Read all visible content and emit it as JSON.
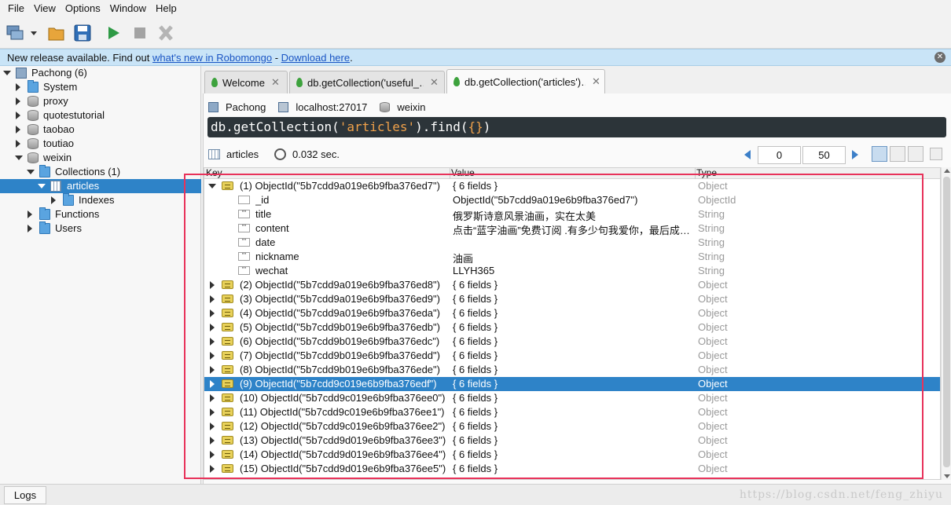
{
  "menu": [
    "File",
    "View",
    "Options",
    "Window",
    "Help"
  ],
  "banner": {
    "text_prefix": "New release available. Find out ",
    "link_whats_new": "what's new in Robomongo",
    "separator": " - ",
    "link_download": "Download here",
    "suffix": "."
  },
  "explorer": {
    "server": "Pachong (6)",
    "nodes": [
      "System",
      "proxy",
      "quotestutorial",
      "taobao",
      "toutiao",
      "weixin",
      "Collections (1)",
      "articles",
      "Indexes",
      "Functions",
      "Users"
    ]
  },
  "tabs": [
    {
      "label": "Welcome"
    },
    {
      "label": "db.getCollection('useful_…"
    },
    {
      "label": "db.getCollection('articles')…"
    }
  ],
  "connection": {
    "server": "Pachong",
    "host": "localhost:27017",
    "database": "weixin"
  },
  "query": {
    "prefix": "db.getCollection(",
    "collection": "'articles'",
    "middle": ").find(",
    "braces": "{}",
    "suffix": ")"
  },
  "result": {
    "collection": "articles",
    "time": "0.032 sec.",
    "skip": "0",
    "limit": "50"
  },
  "columns": {
    "key": "Key",
    "value": "Value",
    "type": "Type"
  },
  "rows": [
    {
      "key": "(1) ObjectId(\"5b7cdd9a019e6b9fba376ed7\")",
      "value": "{ 6 fields }",
      "type": "Object"
    },
    {
      "key": "_id",
      "value": "ObjectId(\"5b7cdd9a019e6b9fba376ed7\")",
      "type": "ObjectId"
    },
    {
      "key": "title",
      "value": "俄罗斯诗意风景油画，实在太美",
      "type": "String"
    },
    {
      "key": "content",
      "value": "点击“蓝字油画”免费订阅 .有多少句我爱你，最后成…",
      "type": "String"
    },
    {
      "key": "date",
      "value": "",
      "type": "String"
    },
    {
      "key": "nickname",
      "value": "油画",
      "type": "String"
    },
    {
      "key": "wechat",
      "value": "LLYH365",
      "type": "String"
    },
    {
      "key": "(2) ObjectId(\"5b7cdd9a019e6b9fba376ed8\")",
      "value": "{ 6 fields }",
      "type": "Object"
    },
    {
      "key": "(3) ObjectId(\"5b7cdd9a019e6b9fba376ed9\")",
      "value": "{ 6 fields }",
      "type": "Object"
    },
    {
      "key": "(4) ObjectId(\"5b7cdd9a019e6b9fba376eda\")",
      "value": "{ 6 fields }",
      "type": "Object"
    },
    {
      "key": "(5) ObjectId(\"5b7cdd9b019e6b9fba376edb\")",
      "value": "{ 6 fields }",
      "type": "Object"
    },
    {
      "key": "(6) ObjectId(\"5b7cdd9b019e6b9fba376edc\")",
      "value": "{ 6 fields }",
      "type": "Object"
    },
    {
      "key": "(7) ObjectId(\"5b7cdd9b019e6b9fba376edd\")",
      "value": "{ 6 fields }",
      "type": "Object"
    },
    {
      "key": "(8) ObjectId(\"5b7cdd9b019e6b9fba376ede\")",
      "value": "{ 6 fields }",
      "type": "Object"
    },
    {
      "key": "(9) ObjectId(\"5b7cdd9c019e6b9fba376edf\")",
      "value": "{ 6 fields }",
      "type": "Object"
    },
    {
      "key": "(10) ObjectId(\"5b7cdd9c019e6b9fba376ee0\")",
      "value": "{ 6 fields }",
      "type": "Object"
    },
    {
      "key": "(11) ObjectId(\"5b7cdd9c019e6b9fba376ee1\")",
      "value": "{ 6 fields }",
      "type": "Object"
    },
    {
      "key": "(12) ObjectId(\"5b7cdd9c019e6b9fba376ee2\")",
      "value": "{ 6 fields }",
      "type": "Object"
    },
    {
      "key": "(13) ObjectId(\"5b7cdd9d019e6b9fba376ee3\")",
      "value": "{ 6 fields }",
      "type": "Object"
    },
    {
      "key": "(14) ObjectId(\"5b7cdd9d019e6b9fba376ee4\")",
      "value": "{ 6 fields }",
      "type": "Object"
    },
    {
      "key": "(15) ObjectId(\"5b7cdd9d019e6b9fba376ee5\")",
      "value": "{ 6 fields }",
      "type": "Object"
    }
  ],
  "status": {
    "logs": "Logs"
  },
  "watermark": "https://blog.csdn.net/feng_zhiyu",
  "colors": {
    "accent": "#2e83c8",
    "banner": "#c9e4f7",
    "highlight": "#e8325a",
    "query_bg": "#2c3439"
  }
}
